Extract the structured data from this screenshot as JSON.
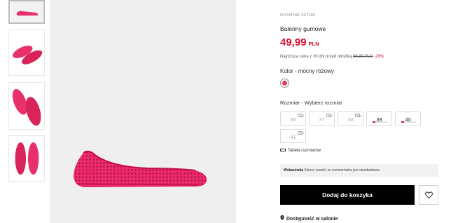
{
  "thumbnails": [
    {
      "name": "thumb-side-view",
      "selected": true
    },
    {
      "name": "thumb-top-pair",
      "selected": false
    },
    {
      "name": "thumb-pair-angled",
      "selected": false
    },
    {
      "name": "thumb-soles",
      "selected": false
    }
  ],
  "main_image": {
    "name": "product-image",
    "subject": "pink jelly ballerina flat"
  },
  "product": {
    "badge": "OSTATNIE SZTUKI",
    "title": "Baleriny gumowe",
    "price": "49,99",
    "currency": "PLN",
    "lowest_prefix": "Najniższa cena z 30 dni przed obniżką",
    "old_price": "69,99 PLN",
    "discount": "-29%",
    "color_label": "Kolor - mocny różowy",
    "color_hex": "#e53a5c",
    "size_label": "Rozmiar  - Wybierz rozmiar",
    "sizes": [
      {
        "label": "36",
        "available": false,
        "stock_fraction": 0
      },
      {
        "label": "37",
        "available": false,
        "stock_fraction": 0
      },
      {
        "label": "38",
        "available": false,
        "stock_fraction": 0
      },
      {
        "label": "39",
        "available": true,
        "stock_fraction": 0.2
      },
      {
        "label": "40",
        "available": true,
        "stock_fraction": 0.2
      },
      {
        "label": "41",
        "available": false,
        "stock_fraction": 0
      }
    ],
    "size_table_link": "Tabela rozmiarów",
    "hint_bold": "Wskazówka",
    "hint_text": " Klienci ocenili, że rozmiarówka jest standardowa.",
    "add_to_cart": "Dodaj do koszyka",
    "store_availability": "Dostępność w salonie"
  },
  "icons": [
    "heart-icon",
    "pin-icon",
    "ruler-icon",
    "mail-icon"
  ],
  "colors": {
    "accent": "#d0102e",
    "button": "#000000"
  }
}
